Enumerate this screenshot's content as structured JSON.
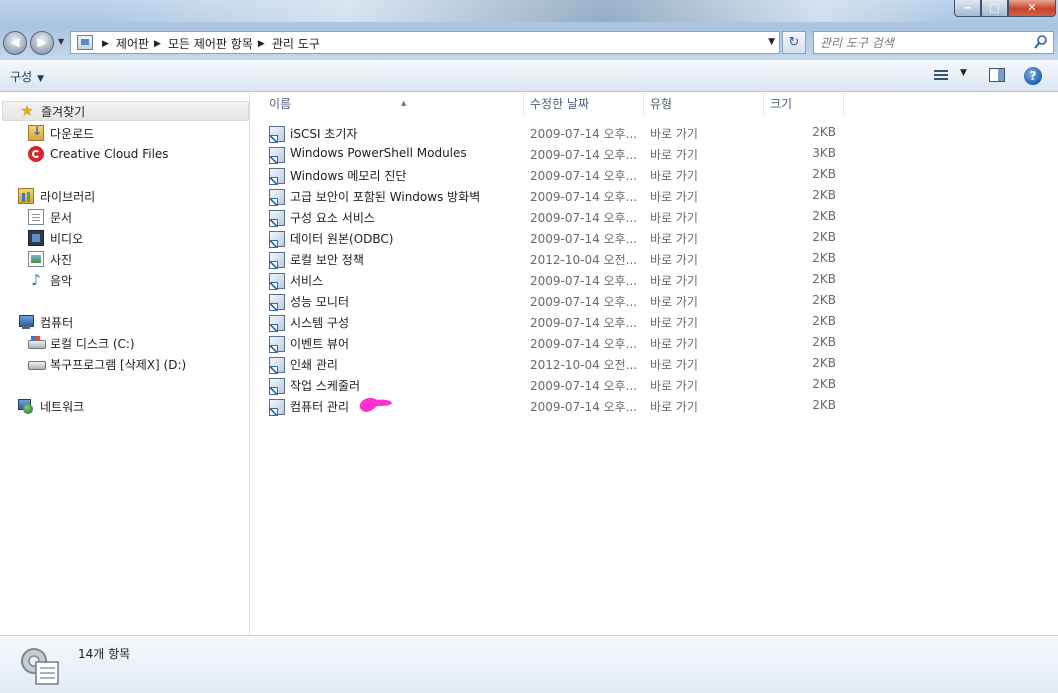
{
  "window": {
    "minimize_glyph": "‒",
    "maximize_glyph": "□",
    "close_glyph": "✕"
  },
  "nav": {
    "back_glyph": "◀",
    "forward_glyph": "▶",
    "history_caret": "▼"
  },
  "address": {
    "icon": "control-panel-icon",
    "breadcrumbs": [
      "제어판",
      "모든 제어판 항목",
      "관리 도구"
    ],
    "separator": "▶",
    "dropdown_caret": "▼"
  },
  "refresh_glyph": "↻",
  "search": {
    "placeholder": "관리 도구 검색",
    "value": ""
  },
  "toolbar": {
    "organize_label": "구성",
    "caret": "▼",
    "help_glyph": "?"
  },
  "sidebar": {
    "favorites": {
      "label": "즐겨찾기",
      "icon": "star-icon"
    },
    "favorite_items": [
      {
        "label": "다운로드",
        "icon": "download-folder-icon"
      },
      {
        "label": "Creative Cloud Files",
        "icon": "creative-cloud-icon"
      }
    ],
    "libraries": {
      "label": "라이브러리",
      "icon": "library-icon"
    },
    "library_items": [
      {
        "label": "문서",
        "icon": "document-icon"
      },
      {
        "label": "비디오",
        "icon": "video-icon"
      },
      {
        "label": "사진",
        "icon": "picture-icon"
      },
      {
        "label": "음악",
        "icon": "music-icon"
      }
    ],
    "computer": {
      "label": "컴퓨터",
      "icon": "computer-icon"
    },
    "computer_items": [
      {
        "label": "로컬 디스크 (C:)",
        "icon": "local-disk-icon"
      },
      {
        "label": "복구프로그램 [삭제X] (D:)",
        "icon": "drive-icon"
      }
    ],
    "network": {
      "label": "네트워크",
      "icon": "network-icon"
    }
  },
  "columns": {
    "name": "이름",
    "date": "수정한 날짜",
    "type": "유형",
    "size": "크기",
    "sort_glyph": "▲"
  },
  "files": [
    {
      "name": "iSCSI 초기자",
      "date": "2009-07-14 오후...",
      "type": "바로 가기",
      "size": "2KB"
    },
    {
      "name": "Windows PowerShell Modules",
      "date": "2009-07-14 오후...",
      "type": "바로 가기",
      "size": "3KB"
    },
    {
      "name": "Windows 메모리 진단",
      "date": "2009-07-14 오후...",
      "type": "바로 가기",
      "size": "2KB"
    },
    {
      "name": "고급 보안이 포함된 Windows 방화벽",
      "date": "2009-07-14 오후...",
      "type": "바로 가기",
      "size": "2KB"
    },
    {
      "name": "구성 요소 서비스",
      "date": "2009-07-14 오후...",
      "type": "바로 가기",
      "size": "2KB"
    },
    {
      "name": "데이터 원본(ODBC)",
      "date": "2009-07-14 오후...",
      "type": "바로 가기",
      "size": "2KB"
    },
    {
      "name": "로컬 보안 정책",
      "date": "2012-10-04 오전...",
      "type": "바로 가기",
      "size": "2KB"
    },
    {
      "name": "서비스",
      "date": "2009-07-14 오후...",
      "type": "바로 가기",
      "size": "2KB"
    },
    {
      "name": "성능 모니터",
      "date": "2009-07-14 오후...",
      "type": "바로 가기",
      "size": "2KB"
    },
    {
      "name": "시스템 구성",
      "date": "2009-07-14 오후...",
      "type": "바로 가기",
      "size": "2KB"
    },
    {
      "name": "이벤트 뷰어",
      "date": "2009-07-14 오후...",
      "type": "바로 가기",
      "size": "2KB"
    },
    {
      "name": "인쇄 관리",
      "date": "2012-10-04 오전...",
      "type": "바로 가기",
      "size": "2KB"
    },
    {
      "name": "작업 스케줄러",
      "date": "2009-07-14 오후...",
      "type": "바로 가기",
      "size": "2KB"
    },
    {
      "name": "컴퓨터 관리",
      "date": "2009-07-14 오후...",
      "type": "바로 가기",
      "size": "2KB"
    }
  ],
  "annotation_color": "#ff2fd2",
  "details": {
    "item_count": "14개 항목"
  }
}
